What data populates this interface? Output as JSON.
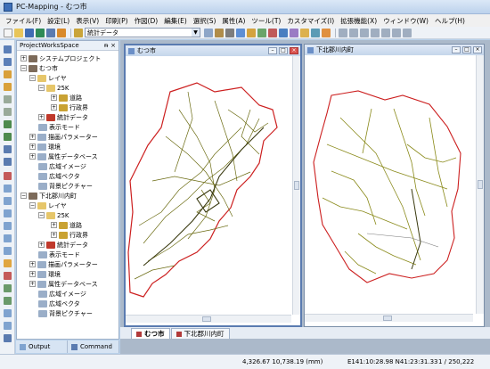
{
  "app": {
    "title": "PC-Mapping - むつ市"
  },
  "menu": [
    "ファイル(F)",
    "設定(L)",
    "表示(V)",
    "印刷(P)",
    "作図(D)",
    "編集(E)",
    "選択(S)",
    "属性(A)",
    "ツール(T)",
    "カスタマイズ(I)",
    "拡張機能(X)",
    "ウィンドウ(W)",
    "ヘルプ(H)"
  ],
  "toolbar": {
    "layer_combo_value": "統計データ"
  },
  "workspace": {
    "title": "ProjectWorksSpace",
    "tree": [
      "システムプロジェクト",
      "むつ市",
      "レイヤ",
      "25K",
      "道路",
      "行政界",
      "統計データ",
      "表示モード",
      "描画パラメーター",
      "環境",
      "属性データベース",
      "広域イメージ",
      "広域ベクタ",
      "背景ピクチャー",
      "下北郡川内町",
      "レイヤ",
      "25K",
      "道路",
      "行政界",
      "統計データ",
      "表示モード",
      "描画パラメーター",
      "環境",
      "属性データベース",
      "広域イメージ",
      "広域ベクタ",
      "背景ピクチャー"
    ]
  },
  "panel_tabs": {
    "output": "Output",
    "command": "Command"
  },
  "windows": {
    "left_title": "むつ市",
    "right_title": "下北郡川内町"
  },
  "doc_tabs": [
    "むつ市",
    "下北郡川内町"
  ],
  "status": {
    "coords": "4,326.67 10,738.19 (mm)",
    "latlon": "E141:10:28.98 N41:23:31.33",
    "scale": "1 / 250,222"
  },
  "colors": {
    "boundary": "#cc1f1f",
    "roads": "#6b6b12",
    "rivers": "#8a8a1a"
  }
}
